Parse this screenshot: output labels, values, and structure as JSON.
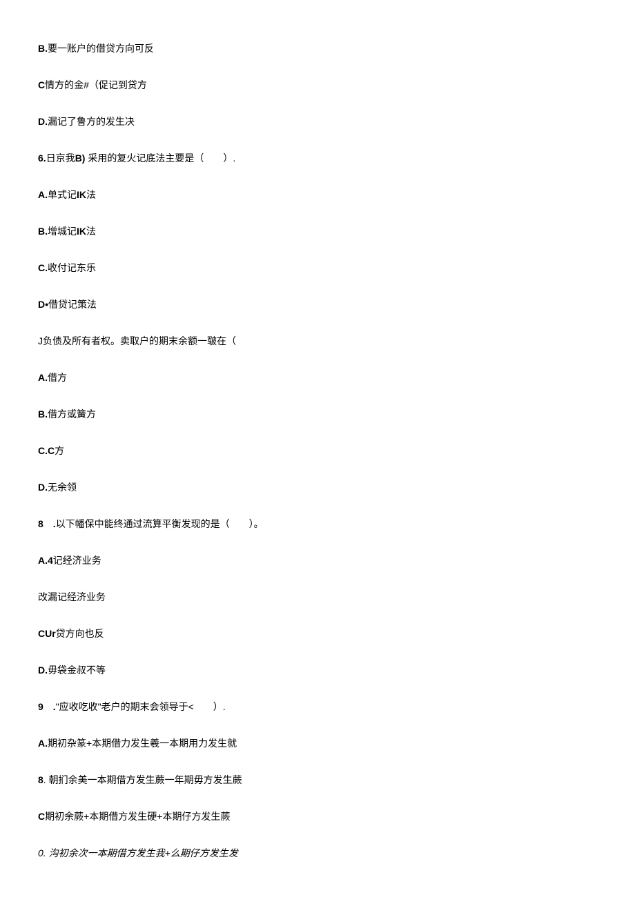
{
  "lines": [
    {
      "prefix": "B.",
      "text": "要一账户的借贷方向可反"
    },
    {
      "prefix": "C",
      "text": "情方的金#（促记到贷方"
    },
    {
      "prefix": "D.",
      "text": "漏记了鲁方的发生决"
    },
    {
      "prefix": "6.",
      "text": "日京我",
      "midBold": "B)",
      "rest": "  采用的复火记底法主要是（　　）."
    },
    {
      "prefix": "A.",
      "text": "单式记",
      "midBold": "IK",
      "rest": "法"
    },
    {
      "prefix": "B.",
      "text": "增城记",
      "midBold": "IK",
      "rest": "法"
    },
    {
      "prefix": "C.",
      "text": "收付记东乐"
    },
    {
      "prefix": "D•",
      "text": "借贷记策法"
    },
    {
      "prefix": "",
      "text": "J负债及所有者权。卖取户的期末余额一皲在（"
    },
    {
      "prefix": "A.",
      "text": "借方"
    },
    {
      "prefix": "B.",
      "text": "借方或簧方"
    },
    {
      "prefix": "C.C",
      "text": "方"
    },
    {
      "prefix": "D.",
      "text": "无余领"
    },
    {
      "prefix": "8　.",
      "text": "以下幡保中能终通过流算平衡发现的是（　　）。"
    },
    {
      "prefix": "A.4",
      "text": "记经济业务"
    },
    {
      "prefix": "",
      "text": "改漏记经济业务"
    },
    {
      "prefix": "CUr",
      "text": "贷方向也反"
    },
    {
      "prefix": "D.",
      "text": "毋袋金叔不等"
    },
    {
      "prefix": "9　.",
      "text": "\"应收吃收\"老户的期末会领导于<　　）."
    },
    {
      "prefix": "A.",
      "text": "期初杂篆+本期借力发生羲一本期用力发生就"
    },
    {
      "prefix": "8",
      "text": ". 朝扪余美一本期借方发生蕨一年期毋方发生蕨"
    },
    {
      "prefix": "C",
      "text": "期初余蕨+本期借方发生硬+本期仔方发生蕨"
    },
    {
      "prefix": "",
      "text": "0. 沟初余次一本期借方发生我+么期仔方发生发",
      "italic": true
    }
  ]
}
